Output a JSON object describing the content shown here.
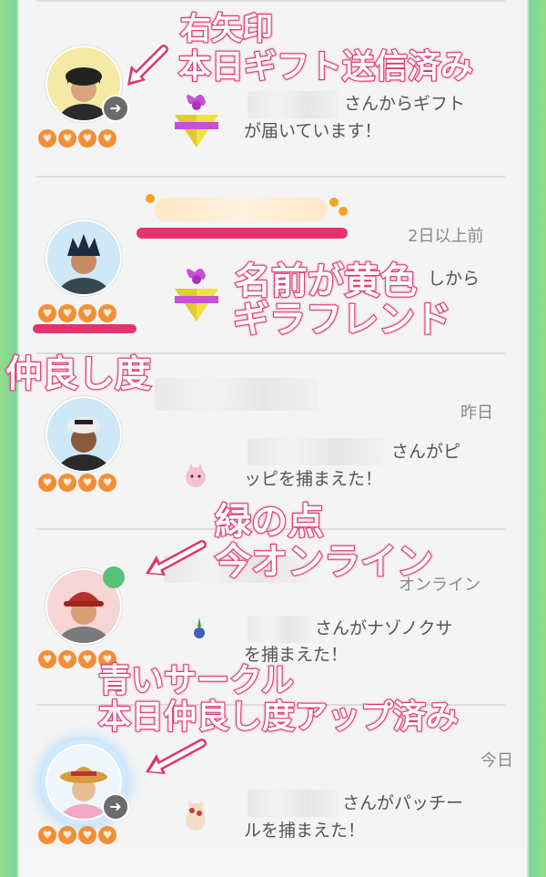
{
  "colors": {
    "heart": "#f28f36",
    "annotation": "#e0336c",
    "online_dot": "#54c47a",
    "name_highlight": "#e5336f"
  },
  "friends": [
    {
      "timestamp": "",
      "message_line1": "さんからギフト",
      "message_line2": "が届いています！",
      "hearts": 4,
      "badge": "arrow-icon",
      "item": "gift-icon"
    },
    {
      "timestamp": "2日以上前",
      "message_line1": "しから",
      "message_line2": "",
      "hearts": 4,
      "badge": "none",
      "item": "gift-icon"
    },
    {
      "timestamp": "昨日",
      "message_line1": "さんがピ",
      "message_line2": "ッピを捕まえた！",
      "hearts": 4,
      "badge": "none",
      "item": "clefairy-icon"
    },
    {
      "timestamp": "オンライン",
      "message_line1": "さんがナゾノクサ",
      "message_line2": "を捕まえた！",
      "hearts": 4,
      "badge": "online-dot",
      "item": "oddish-icon"
    },
    {
      "timestamp": "今日",
      "message_line1": "さんがパッチー",
      "message_line2": "ルを捕まえた！",
      "hearts": 4,
      "badge": "arrow-icon",
      "item": "spinda-icon"
    }
  ],
  "annotations": {
    "a1_line1": "右矢印",
    "a1_line2": "本日ギフト送信済み",
    "a2_line1": "名前が黄色",
    "a2_line2": "ギラフレンド",
    "a3": "仲良し度",
    "a4_line1": "緑の点",
    "a4_line2": "今オンライン",
    "a5_line1": "青いサークル",
    "a5_line2": "本日仲良し度アップ済み"
  }
}
